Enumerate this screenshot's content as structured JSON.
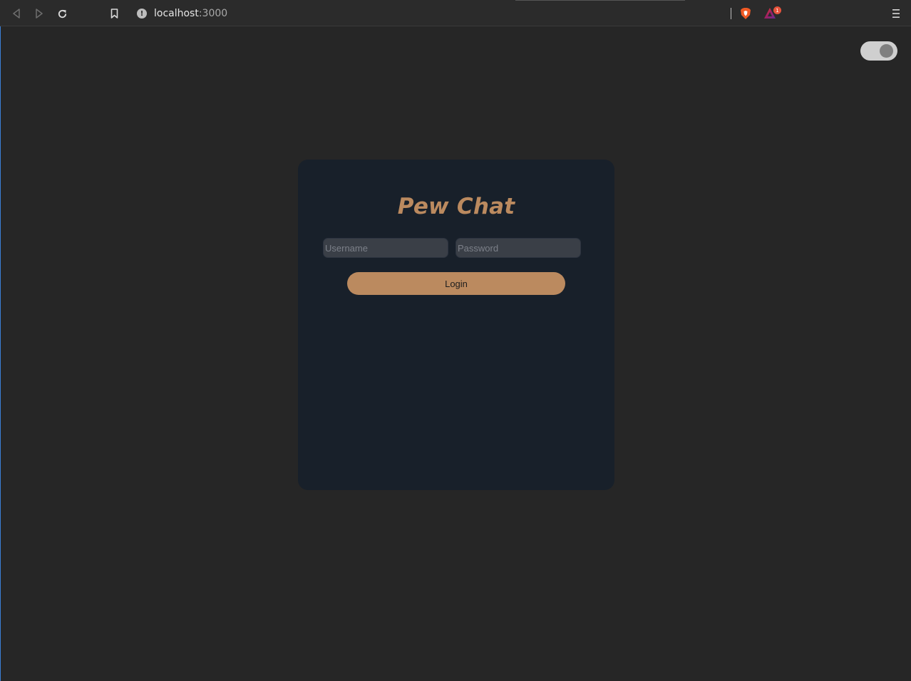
{
  "browser": {
    "url_host": "localhost",
    "url_port": ":3000",
    "info_icon": "info-icon",
    "rewards_badge_count": "1"
  },
  "theme_toggle": {
    "state": "dark"
  },
  "login": {
    "title": "Pew Chat",
    "username_placeholder": "Username",
    "password_placeholder": "Password",
    "button_label": "Login"
  },
  "colors": {
    "accent": "#bb8a5f",
    "card_background": "#18202a",
    "page_background": "#262626"
  }
}
